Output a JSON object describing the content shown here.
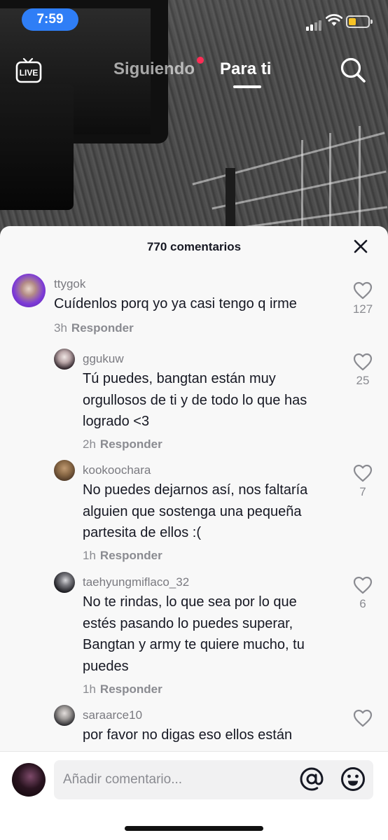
{
  "status_bar": {
    "time": "7:59",
    "battery_color": "#f7c325"
  },
  "top_nav": {
    "live_label": "LIVE",
    "tab_following": "Siguiendo",
    "tab_for_you": "Para ti",
    "active_tab": "Para ti"
  },
  "comments_panel": {
    "title": "770 comentarios",
    "comments": [
      {
        "username": "ttygok",
        "text": "Cuídenlos porq yo ya casi tengo q irme",
        "time": "3h",
        "reply_label": "Responder",
        "likes": "127"
      },
      {
        "username": "ggukuw",
        "text_lines": [
          "Tú puedes, bangtan están muy",
          "orgullosos de ti y de todo lo que has",
          "logrado <3"
        ],
        "time": "2h",
        "reply_label": "Responder",
        "likes": "25"
      },
      {
        "username": "kookoochara",
        "text_lines": [
          "No puedes dejarnos así, nos faltaría",
          "alguien que sostenga una pequeña",
          "partesita de ellos :("
        ],
        "time": "1h",
        "reply_label": "Responder",
        "likes": "7"
      },
      {
        "username": "taehyungmiflaco_32",
        "text_lines": [
          "No te rindas, lo que sea por lo que",
          "estés pasando lo puedes superar,",
          "Bangtan y army te quiere mucho, tu",
          "puedes"
        ],
        "time": "1h",
        "reply_label": "Responder",
        "likes": "6"
      },
      {
        "username": "saraarce10",
        "text_lines": [
          "por favor no digas eso ellos están"
        ]
      }
    ]
  },
  "input_bar": {
    "placeholder": "Añadir comentario..."
  },
  "colors": {
    "accent_red": "#fe2c55",
    "time_pill": "#2f7ef6",
    "sheet_bg": "#f8f8f8"
  }
}
